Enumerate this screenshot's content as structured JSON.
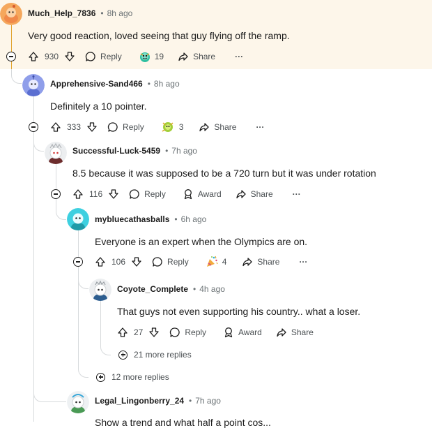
{
  "comments": [
    {
      "username": "Much_Help_7836",
      "time": "8h ago",
      "body": "Very good reaction, loved seeing that guy flying off the ramp.",
      "votes": "930",
      "reply_label": "Reply",
      "award_count": "19",
      "share_label": "Share",
      "more_label": "···"
    },
    {
      "username": "Apprehensive-Sand466",
      "time": "8h ago",
      "body": "Definitely a 10 pointer.",
      "votes": "333",
      "reply_label": "Reply",
      "award_count": "3",
      "share_label": "Share",
      "more_label": "···"
    },
    {
      "username": "Successful-Luck-5459",
      "time": "7h ago",
      "body": "8.5 because it was supposed to be a 720 turn but it was under rotation",
      "votes": "116",
      "reply_label": "Reply",
      "award_label": "Award",
      "share_label": "Share",
      "more_label": "···"
    },
    {
      "username": "mybluecathasballs",
      "time": "6h ago",
      "body": "Everyone is an expert when the Olympics are on.",
      "votes": "106",
      "reply_label": "Reply",
      "award_count": "4",
      "share_label": "Share",
      "more_label": "···"
    },
    {
      "username": "Coyote_Complete",
      "time": "4h ago",
      "body": "That guys not even supporting his country.. what a loser.",
      "votes": "27",
      "reply_label": "Reply",
      "award_label": "Award",
      "share_label": "Share"
    },
    {
      "username": "Legal_Lingonberry_24",
      "time": "7h ago",
      "body": "Show a trend and what half a point cos..."
    }
  ],
  "more_replies": {
    "deep": "21 more replies",
    "level2": "12 more replies"
  },
  "dot": "•",
  "colors": {
    "highlight": "#fdf6ea",
    "thread_active": "#e2a633",
    "thread": "#d7dadc",
    "muted": "#6b7275"
  }
}
